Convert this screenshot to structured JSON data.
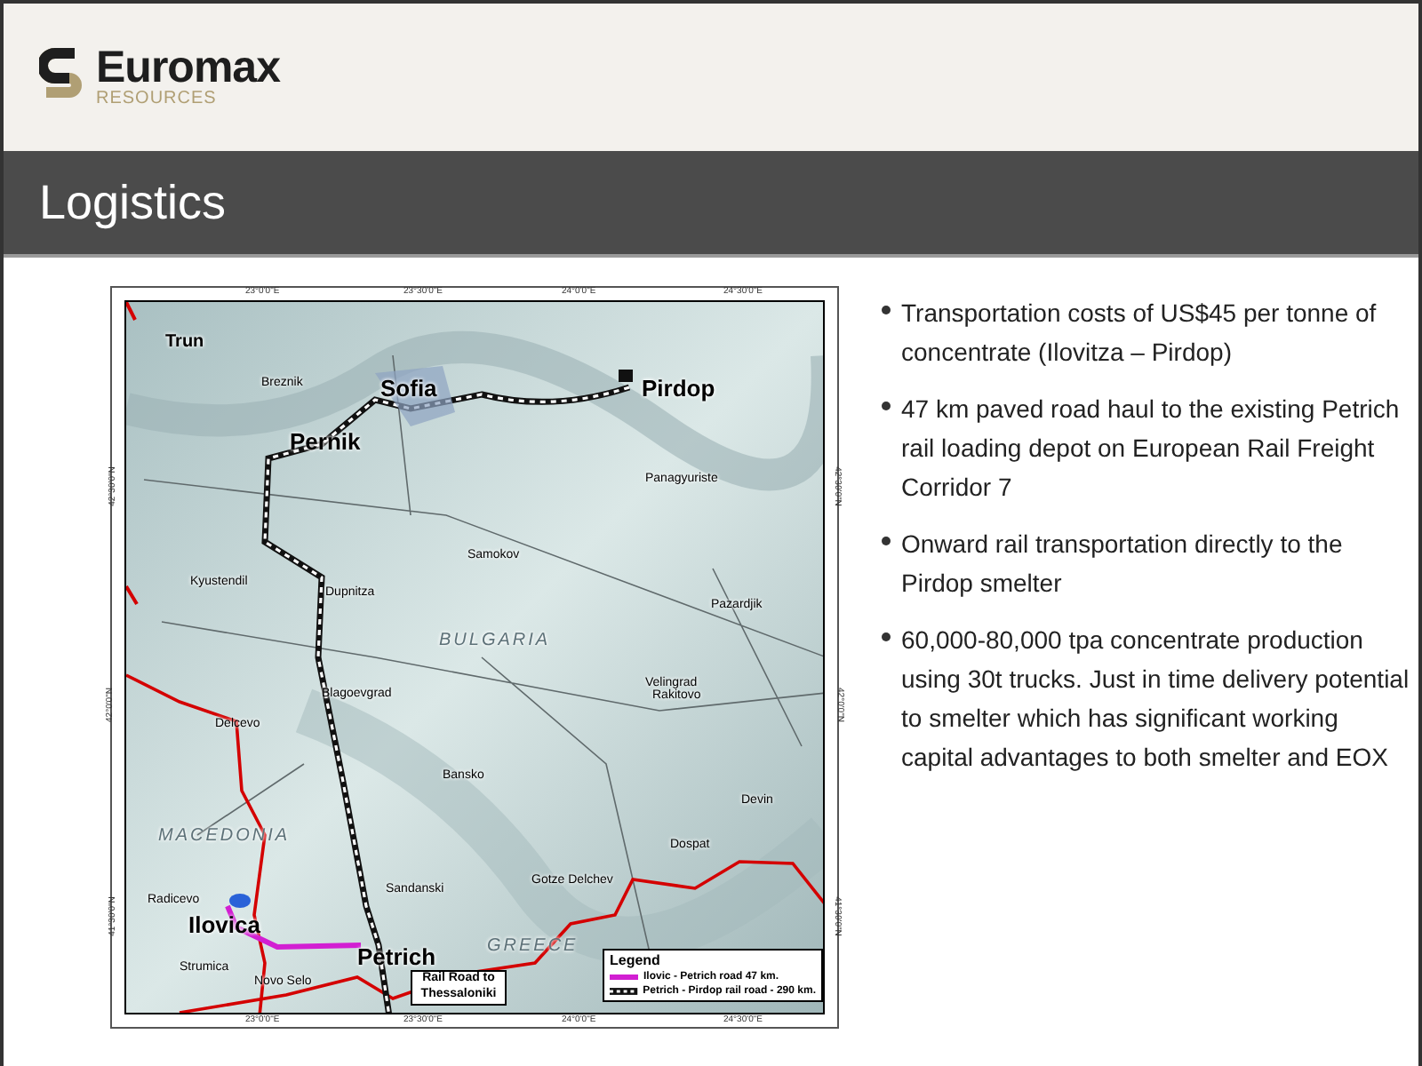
{
  "logo": {
    "name": "Euromax",
    "sub": "RESOURCES"
  },
  "title": "Logistics",
  "map": {
    "labels": [
      {
        "text": "Trun",
        "kind": "town_bold"
      },
      {
        "text": "Breznik",
        "kind": "town"
      },
      {
        "text": "Sofia",
        "kind": "city"
      },
      {
        "text": "Pirdop",
        "kind": "city"
      },
      {
        "text": "Pernik",
        "kind": "city"
      },
      {
        "text": "Panagyuriste",
        "kind": "town"
      },
      {
        "text": "Samokov",
        "kind": "town"
      },
      {
        "text": "Kyustendil",
        "kind": "town"
      },
      {
        "text": "Dupnitza",
        "kind": "town"
      },
      {
        "text": "Pazardjik",
        "kind": "town"
      },
      {
        "text": "BULGARIA",
        "kind": "country"
      },
      {
        "text": "Velingrad",
        "kind": "town"
      },
      {
        "text": "Blagoevgrad",
        "kind": "town"
      },
      {
        "text": "Rakitovo",
        "kind": "town"
      },
      {
        "text": "Delcevo",
        "kind": "town"
      },
      {
        "text": "Bansko",
        "kind": "town"
      },
      {
        "text": "Devin",
        "kind": "town"
      },
      {
        "text": "MACEDONIA",
        "kind": "country"
      },
      {
        "text": "Dospat",
        "kind": "town"
      },
      {
        "text": "Gotze Delchev",
        "kind": "town"
      },
      {
        "text": "Sandanski",
        "kind": "town"
      },
      {
        "text": "Radicevo",
        "kind": "town"
      },
      {
        "text": "Ilovica",
        "kind": "city"
      },
      {
        "text": "Petrich",
        "kind": "city"
      },
      {
        "text": "Strumica",
        "kind": "town"
      },
      {
        "text": "Novo Selo",
        "kind": "town"
      },
      {
        "text": "GREECE",
        "kind": "country"
      }
    ],
    "top_ticks": [
      "23°0'0\"E",
      "23°30'0\"E",
      "24°0'0\"E",
      "24°30'0\"E"
    ],
    "bottom_ticks": [
      "23°0'0\"E",
      "23°30'0\"E",
      "24°0'0\"E",
      "24°30'0\"E"
    ],
    "left_ticks": [
      "42°30'0\"N",
      "42°0'0\"N",
      "41°30'0\"N"
    ],
    "right_ticks": [
      "42°30'0\"N",
      "42°0'0\"N",
      "41°30'0\"N"
    ],
    "callout": "Rail Road to Thessaloniki",
    "legend": {
      "title": "Legend",
      "items": [
        {
          "kind": "road",
          "label": "Ilovic - Petrich road 47 km."
        },
        {
          "kind": "rail",
          "label": "Petrich - Pirdop rail road - 290 km."
        }
      ]
    }
  },
  "bullets": [
    "Transportation costs of US$45 per tonne of concentrate (Ilovitza – Pirdop)",
    "47 km paved road haul to the existing Petrich rail loading depot on European Rail Freight Corridor 7",
    "Onward rail transportation directly to the Pirdop smelter",
    "60,000-80,000 tpa concentrate production using 30t trucks. Just in time delivery potential to smelter which has significant working capital advantages to both smelter and EOX"
  ]
}
